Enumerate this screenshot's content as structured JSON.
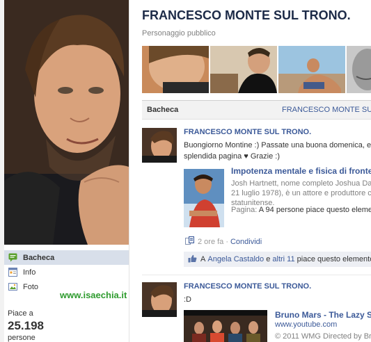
{
  "page": {
    "title": "FRANCESCO MONTE SUL TRONO.",
    "category": "Personaggio pubblico"
  },
  "sidebar": {
    "items": [
      {
        "label": "Bacheca",
        "icon": "wall-icon"
      },
      {
        "label": "Info",
        "icon": "info-icon"
      },
      {
        "label": "Foto",
        "icon": "photo-icon"
      }
    ],
    "likes_label": "Piace a",
    "likes_count": "25.198",
    "likes_unit": "persone"
  },
  "watermark": "www.isaechia.it",
  "tabs": {
    "wall": "Bacheca",
    "name": "FRANCESCO MONTE SUL TR"
  },
  "posts": [
    {
      "author": "FRANCESCO MONTE SUL TRONO.",
      "message_line1": "Buongiorno Montine :) Passate una buona domenica, e s",
      "message_line2": "splendida pagina ♥ Grazie :)",
      "attachment": {
        "title": "Impotenza mentale e fisica di fronte",
        "line1": "Josh Hartnett, nome completo Joshua Dar",
        "line2": "21 luglio 1978), è un attore e produttore c",
        "line3": "statunitense.",
        "meta_label": "Pagina:",
        "meta_text": "A 94 persone piace questo elemen"
      },
      "time": "2 ore fa",
      "dot": "·",
      "share": "Condividi",
      "likes": {
        "prefix": "A",
        "name": "Angela Castaldo",
        "conj": "e",
        "others": "altri 11",
        "suffix": "piace questo elemento"
      }
    },
    {
      "author": "FRANCESCO MONTE SUL TRONO.",
      "message_line1": ":D",
      "attachment": {
        "title": "Bruno Mars - The Lazy So",
        "url": "www.youtube.com",
        "line1": "© 2011 WMG Directed by Bru"
      }
    }
  ],
  "colors": {
    "link": "#3b5998",
    "title": "#1c2a47",
    "tab_bg": "#f2f2f2",
    "nav_active": "#d8dfea",
    "watermark": "#2e9b2e"
  }
}
